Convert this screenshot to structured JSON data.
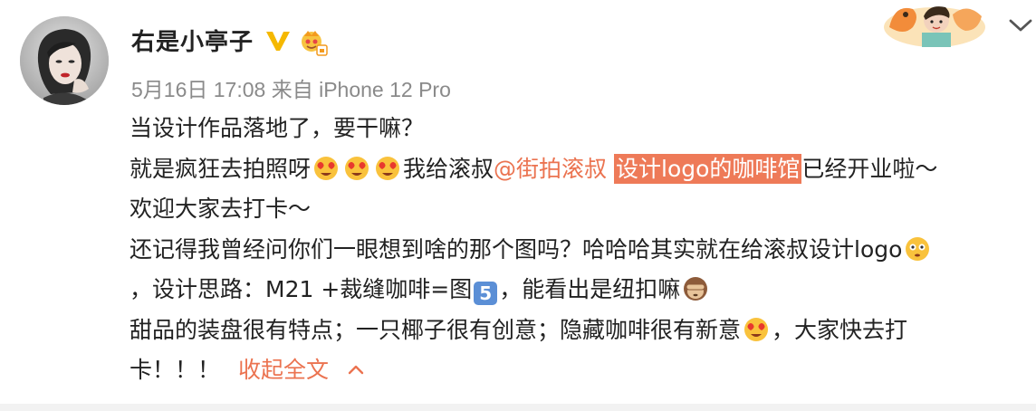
{
  "post": {
    "username": "右是小亭子",
    "meta": "5月16日 17:08 来自 iPhone 12 Pro"
  },
  "content": {
    "line1": "当设计作品落地了，要干嘛？",
    "line2_a": "就是疯狂去拍照呀",
    "line2_b": "我给滚叔",
    "line2_mention": "@街拍滚叔",
    "line2_highlight": "设计logo的咖啡馆",
    "line2_c": "已经开业啦～",
    "line3": "欢迎大家去打卡～",
    "line4": "还记得我曾经问你们一眼想到啥的那个图吗？哈哈哈其实就在给滚叔设计logo",
    "line5_a": "，设计思路：M21 +裁缝咖啡=图",
    "line5_keycap": "5",
    "line5_b": "，能看出是纽扣嘛",
    "line6_a": "甜品的装盘很有特点；一只椰子很有创意；隐藏咖啡很有新意",
    "line6_b": "，大家快去打",
    "line7": "卡！！！",
    "collapse_label": "收起全文"
  },
  "icons": {
    "verified": "v-verified-badge",
    "vip": "crown-vip-icon",
    "heart_eyes": "heart-eyes-emoji",
    "see_no_evil": "see-no-evil-monkey-emoji",
    "flushed": "flushed-face-emoji",
    "expand": "chevron-down-icon",
    "collapse": "chevron-up-icon"
  },
  "colors": {
    "link": "#eb7350",
    "highlight_bg": "#ee7a58",
    "verified": "#f5b800",
    "meta": "#8a8a8a"
  }
}
